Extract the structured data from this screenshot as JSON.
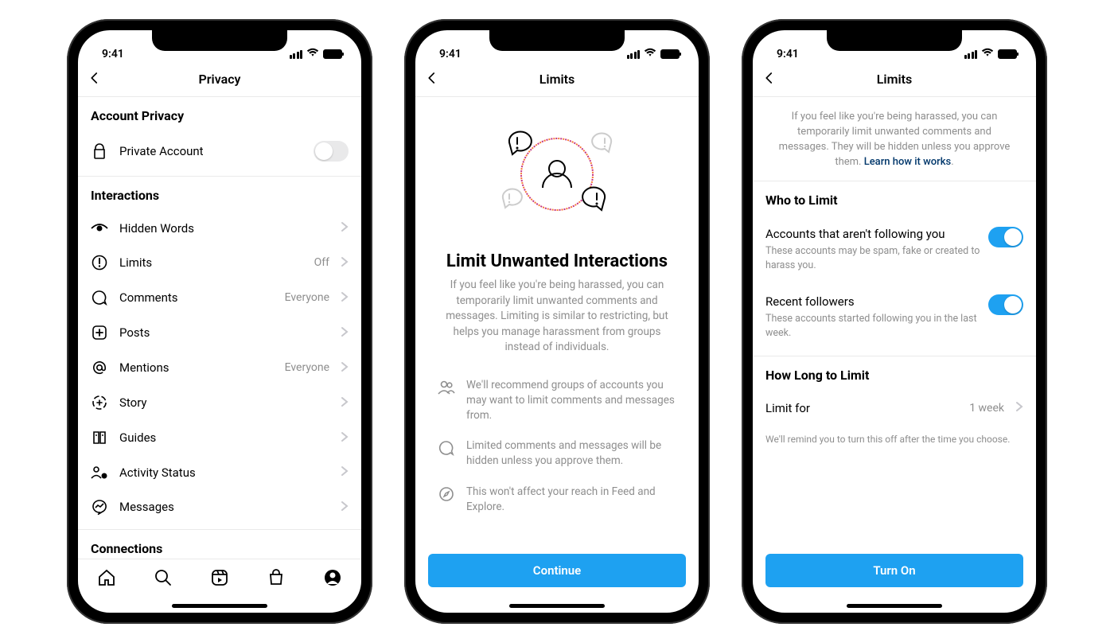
{
  "status_time": "9:41",
  "screen1": {
    "title": "Privacy",
    "account_privacy_header": "Account Privacy",
    "private_account": "Private Account",
    "interactions_header": "Interactions",
    "items": {
      "hidden_words": "Hidden Words",
      "limits": "Limits",
      "limits_value": "Off",
      "comments": "Comments",
      "comments_value": "Everyone",
      "posts": "Posts",
      "mentions": "Mentions",
      "mentions_value": "Everyone",
      "story": "Story",
      "guides": "Guides",
      "activity_status": "Activity Status",
      "messages": "Messages"
    },
    "connections_header": "Connections"
  },
  "screen2": {
    "title": "Limits",
    "heading": "Limit Unwanted Interactions",
    "description": "If you feel like you're being harassed, you can temporarily limit unwanted comments and messages. Limiting is similar to restricting, but helps you manage harassment from groups instead of individuals.",
    "bullets": {
      "b1": "We'll recommend groups of accounts you may want to limit comments and messages from.",
      "b2": "Limited comments and messages will be hidden unless you approve them.",
      "b3": "This won't affect your reach in Feed and Explore."
    },
    "button": "Continue"
  },
  "screen3": {
    "title": "Limits",
    "intro": "If you feel like you're being harassed, you can temporarily limit unwanted comments and messages. They will be hidden unless you approve them. ",
    "intro_link": "Learn how it works",
    "who_header": "Who to Limit",
    "opt1_title": "Accounts that aren't following you",
    "opt1_sub": "These accounts may be spam, fake or created to harass you.",
    "opt2_title": "Recent followers",
    "opt2_sub": "These accounts started following you in the last week.",
    "howlong_header": "How Long to Limit",
    "limit_for": "Limit for",
    "limit_for_value": "1 week",
    "reminder": "We'll remind you to turn this off after the time you choose.",
    "button": "Turn On"
  }
}
